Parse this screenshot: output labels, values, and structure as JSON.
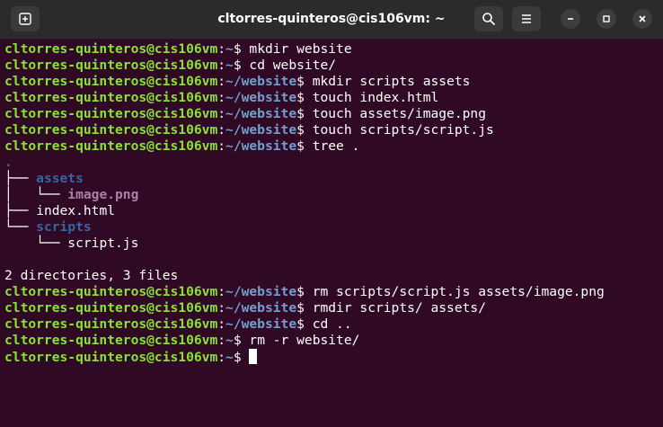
{
  "window": {
    "title": "cltorres-quinteros@cis106vm: ~"
  },
  "icons": {
    "new_tab": "new-tab-icon",
    "search": "search-icon",
    "menu": "hamburger-menu-icon",
    "minimize": "minimize-icon",
    "maximize": "maximize-icon",
    "close": "close-icon"
  },
  "colors": {
    "background": "#300a24",
    "prompt_user": "#8ae234",
    "prompt_path": "#729fcf",
    "directory": "#3465a4",
    "image_file": "#ad7fa8"
  },
  "terminal": {
    "user": "cltorres-quinteros@cis106vm",
    "lines": [
      {
        "type": "prompt",
        "path": "~",
        "cmd": " mkdir website"
      },
      {
        "type": "prompt",
        "path": "~",
        "cmd": " cd website/"
      },
      {
        "type": "prompt",
        "path": "~/website",
        "cmd": " mkdir scripts assets"
      },
      {
        "type": "prompt",
        "path": "~/website",
        "cmd": " touch index.html"
      },
      {
        "type": "prompt",
        "path": "~/website",
        "cmd": " touch assets/image.png"
      },
      {
        "type": "prompt",
        "path": "~/website",
        "cmd": " touch scripts/script.js"
      },
      {
        "type": "prompt",
        "path": "~/website",
        "cmd": " tree ."
      }
    ],
    "tree": {
      "root": ".",
      "assets_branch": "├── ",
      "assets_name": "assets",
      "image_branch": "│   └── ",
      "image_name": "image.png",
      "index_branch": "├── ",
      "index_name": "index.html",
      "scripts_branch": "└── ",
      "scripts_name": "scripts",
      "script_branch": "    └── ",
      "script_name": "script.js",
      "summary": "2 directories, 3 files"
    },
    "after": [
      {
        "type": "prompt",
        "path": "~/website",
        "cmd": " rm scripts/script.js assets/image.png"
      },
      {
        "type": "prompt",
        "path": "~/website",
        "cmd": " rmdir scripts/ assets/"
      },
      {
        "type": "prompt",
        "path": "~/website",
        "cmd": " cd .."
      },
      {
        "type": "prompt",
        "path": "~",
        "cmd": " rm -r website/"
      },
      {
        "type": "prompt",
        "path": "~",
        "cmd": " "
      }
    ]
  }
}
